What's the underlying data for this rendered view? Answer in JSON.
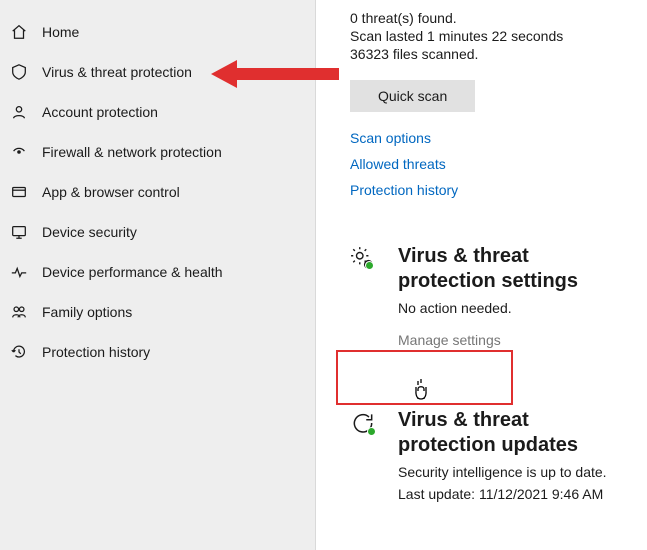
{
  "sidebar": {
    "items": [
      {
        "label": "Home",
        "icon": "home"
      },
      {
        "label": "Virus & threat protection",
        "icon": "shield"
      },
      {
        "label": "Account protection",
        "icon": "account"
      },
      {
        "label": "Firewall & network protection",
        "icon": "wifi"
      },
      {
        "label": "App & browser control",
        "icon": "app"
      },
      {
        "label": "Device security",
        "icon": "device"
      },
      {
        "label": "Device performance & health",
        "icon": "health"
      },
      {
        "label": "Family options",
        "icon": "family"
      },
      {
        "label": "Protection history",
        "icon": "history"
      }
    ]
  },
  "scan": {
    "threats": "0 threat(s) found.",
    "duration": "Scan lasted 1 minutes 22 seconds",
    "files": "36323 files scanned.",
    "quick_btn": "Quick scan",
    "links": {
      "options": "Scan options",
      "allowed": "Allowed threats",
      "history": "Protection history"
    }
  },
  "settings": {
    "title": "Virus & threat protection settings",
    "status": "No action needed.",
    "manage": "Manage settings"
  },
  "updates": {
    "title": "Virus & threat protection updates",
    "status": "Security intelligence is up to date.",
    "last": "Last update: 11/12/2021 9:46 AM"
  }
}
